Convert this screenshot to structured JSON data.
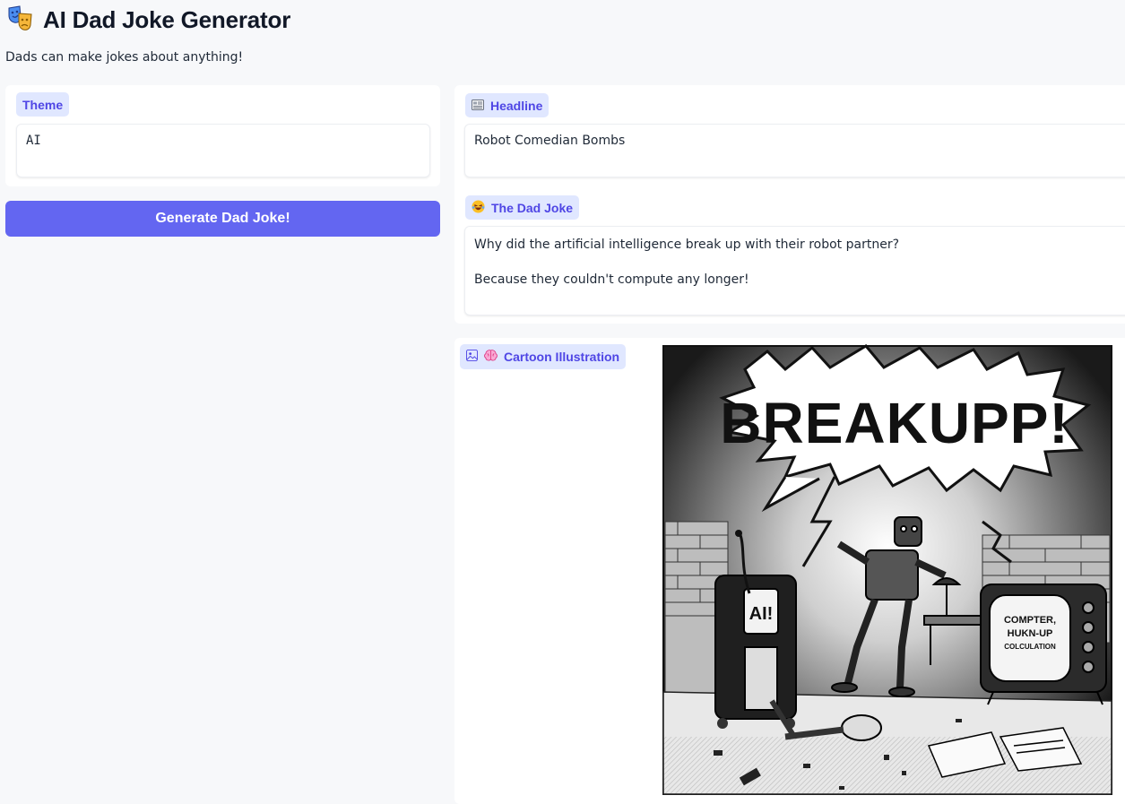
{
  "app": {
    "title": "AI Dad Joke Generator",
    "subtitle": "Dads can make jokes about anything!",
    "icon": "theater-masks-icon"
  },
  "inputs": {
    "theme_label": "Theme",
    "theme_value": "AI",
    "generate_label": "Generate Dad Joke!"
  },
  "outputs": {
    "headline_label": "Headline",
    "headline_icon": "newspaper-icon",
    "headline_value": "Robot Comedian Bombs",
    "joke_label": "The Dad Joke",
    "joke_icon": "laughing-face-icon",
    "joke_line1": "Why did the artificial intelligence break up with their robot partner?",
    "joke_line2": "Because they couldn't compute any longer!",
    "illustration_label": "Cartoon Illustration",
    "illustration_icon": "brain-icon",
    "image_text": {
      "burst": "BREAKUPP!",
      "cabinet_sign": "AI!",
      "tv_line1": "COMPTER,",
      "tv_line2": "HUKN-UP",
      "tv_line3": "COLCULATION"
    }
  },
  "colors": {
    "accent": "#6366f1",
    "chip_bg": "#e0e7ff",
    "chip_text": "#4f46e5",
    "page_bg": "#f7f8fa"
  }
}
